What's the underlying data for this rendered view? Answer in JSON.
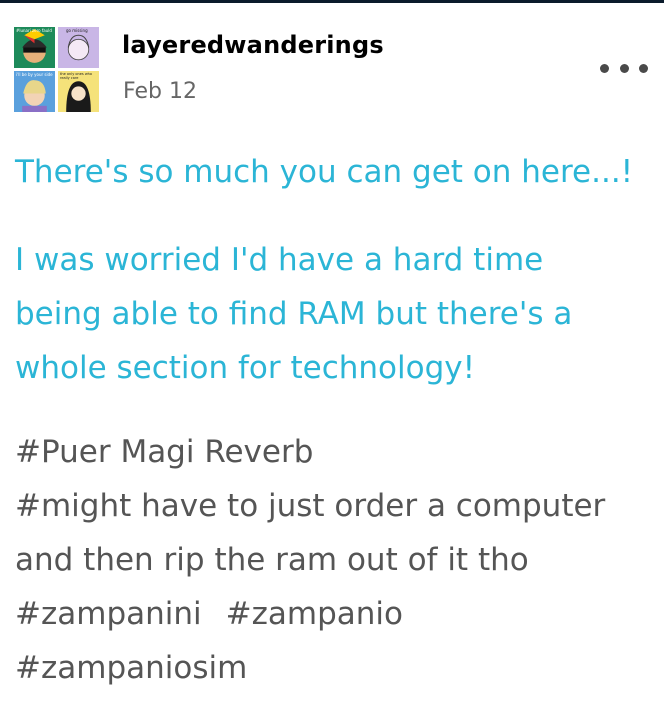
{
  "post": {
    "username": "layeredwanderings",
    "date": "Feb 12",
    "avatar": {
      "q1_text": "#lunari zero fauld",
      "q2_text": "go missing",
      "q3_text": "i'll be by your side",
      "q4_text": "the only ones who really care",
      "colors": {
        "q1": "#1d8a5a",
        "q2": "#c9b6e6",
        "q3": "#5aa0dd",
        "q4": "#f5e27a"
      }
    },
    "paragraphs": [
      "There's so much you can get on here...!",
      "I was worried I'd have a hard time being able to find RAM but there's a whole section for technology!"
    ],
    "tags": [
      "#Puer Magi Reverb",
      "#might have to just order a computer and then rip the ram out of it tho",
      "#zampanini",
      "#zampanio",
      "#zampaniosim"
    ],
    "more_icon": "ellipsis-icon",
    "colors": {
      "body_text": "#2bb5d6",
      "tag_text": "#555555",
      "date_text": "#666666"
    }
  }
}
